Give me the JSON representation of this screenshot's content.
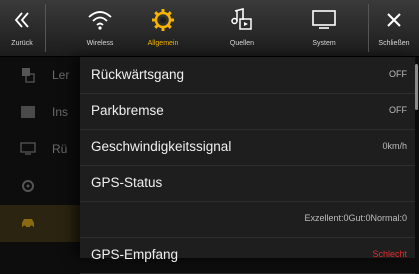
{
  "toolbar": {
    "back_label": "Zurück",
    "tabs": [
      {
        "label": "Wireless",
        "icon": "wifi-icon"
      },
      {
        "label": "Allgemein",
        "icon": "gear-icon"
      },
      {
        "label": "Quellen",
        "icon": "music-source-icon"
      },
      {
        "label": "System",
        "icon": "monitor-icon"
      }
    ],
    "close_label": "Schließen"
  },
  "colors": {
    "accent": "#f4b400",
    "warning": "#e32b2b"
  },
  "background_menu": {
    "items": [
      {
        "label": "Ler",
        "icon": "language-icon"
      },
      {
        "label": "Ins",
        "icon": "install-icon"
      },
      {
        "label": "Rü",
        "icon": "display-icon"
      },
      {
        "label": "",
        "icon": "gear-icon"
      },
      {
        "label": "",
        "icon": "car-icon"
      }
    ]
  },
  "settings": {
    "rows": [
      {
        "name": "Rückwärtsgang",
        "value": "OFF"
      },
      {
        "name": "Parkbremse",
        "value": "OFF"
      },
      {
        "name": "Geschwindigkeitssignal",
        "value": "0km/h"
      },
      {
        "name": "GPS-Status",
        "value": ""
      },
      {
        "name": "",
        "value": "Exzellent:0Gut:0Normal:0"
      },
      {
        "name": "GPS-Empfang",
        "value": "Schlecht"
      }
    ]
  }
}
